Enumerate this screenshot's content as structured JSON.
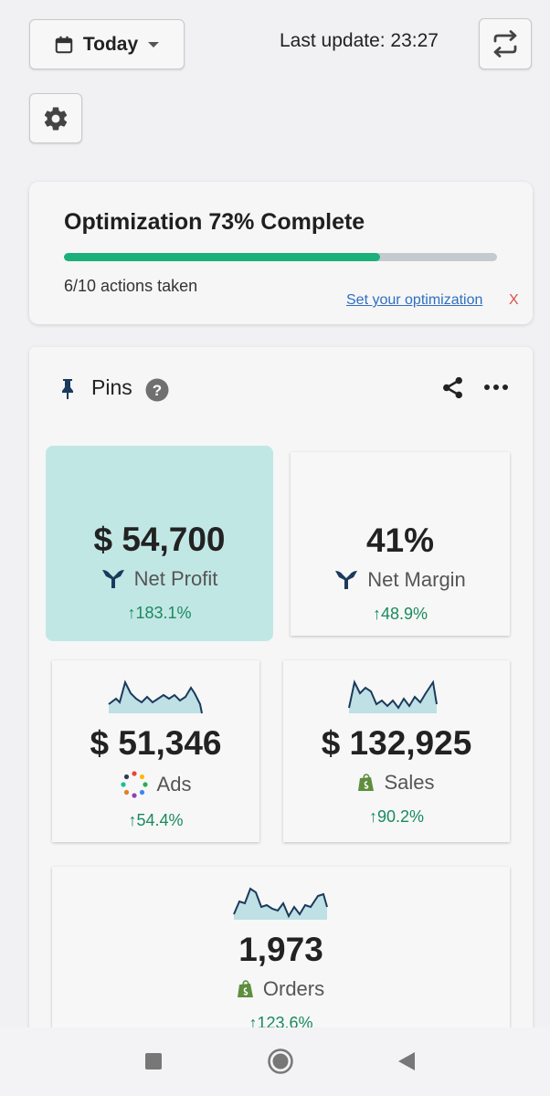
{
  "header": {
    "date_label": "Today",
    "last_update": "Last update: 23:27"
  },
  "optimization": {
    "title": "Optimization 73% Complete",
    "progress_percent": 73,
    "actions_text": "6/10 actions taken",
    "link_label": "Set your optimization",
    "close_label": "X"
  },
  "pins": {
    "title": "Pins",
    "tiles": [
      {
        "value": "$ 54,700",
        "label": "Net Profit",
        "change": "↑183.1%",
        "icon": "trident-icon"
      },
      {
        "value": "41%",
        "label": "Net Margin",
        "change": "↑48.9%",
        "icon": "trident-icon"
      },
      {
        "value": "$ 51,346",
        "label": "Ads",
        "change": "↑54.4%",
        "icon": "ads-dots-icon"
      },
      {
        "value": "$ 132,925",
        "label": "Sales",
        "change": "↑90.2%",
        "icon": "shopify-bag-icon"
      },
      {
        "value": "1,973",
        "label": "Orders",
        "change": "↑123.6%",
        "icon": "shopify-bag-icon"
      }
    ]
  },
  "colors": {
    "accent_green": "#1ab07a",
    "highlight_tile": "#c1e7e5",
    "change_green": "#1a8a5c",
    "link_blue": "#2f6fbf",
    "close_red": "#d9534f",
    "brand_navy": "#1b3a5c"
  }
}
